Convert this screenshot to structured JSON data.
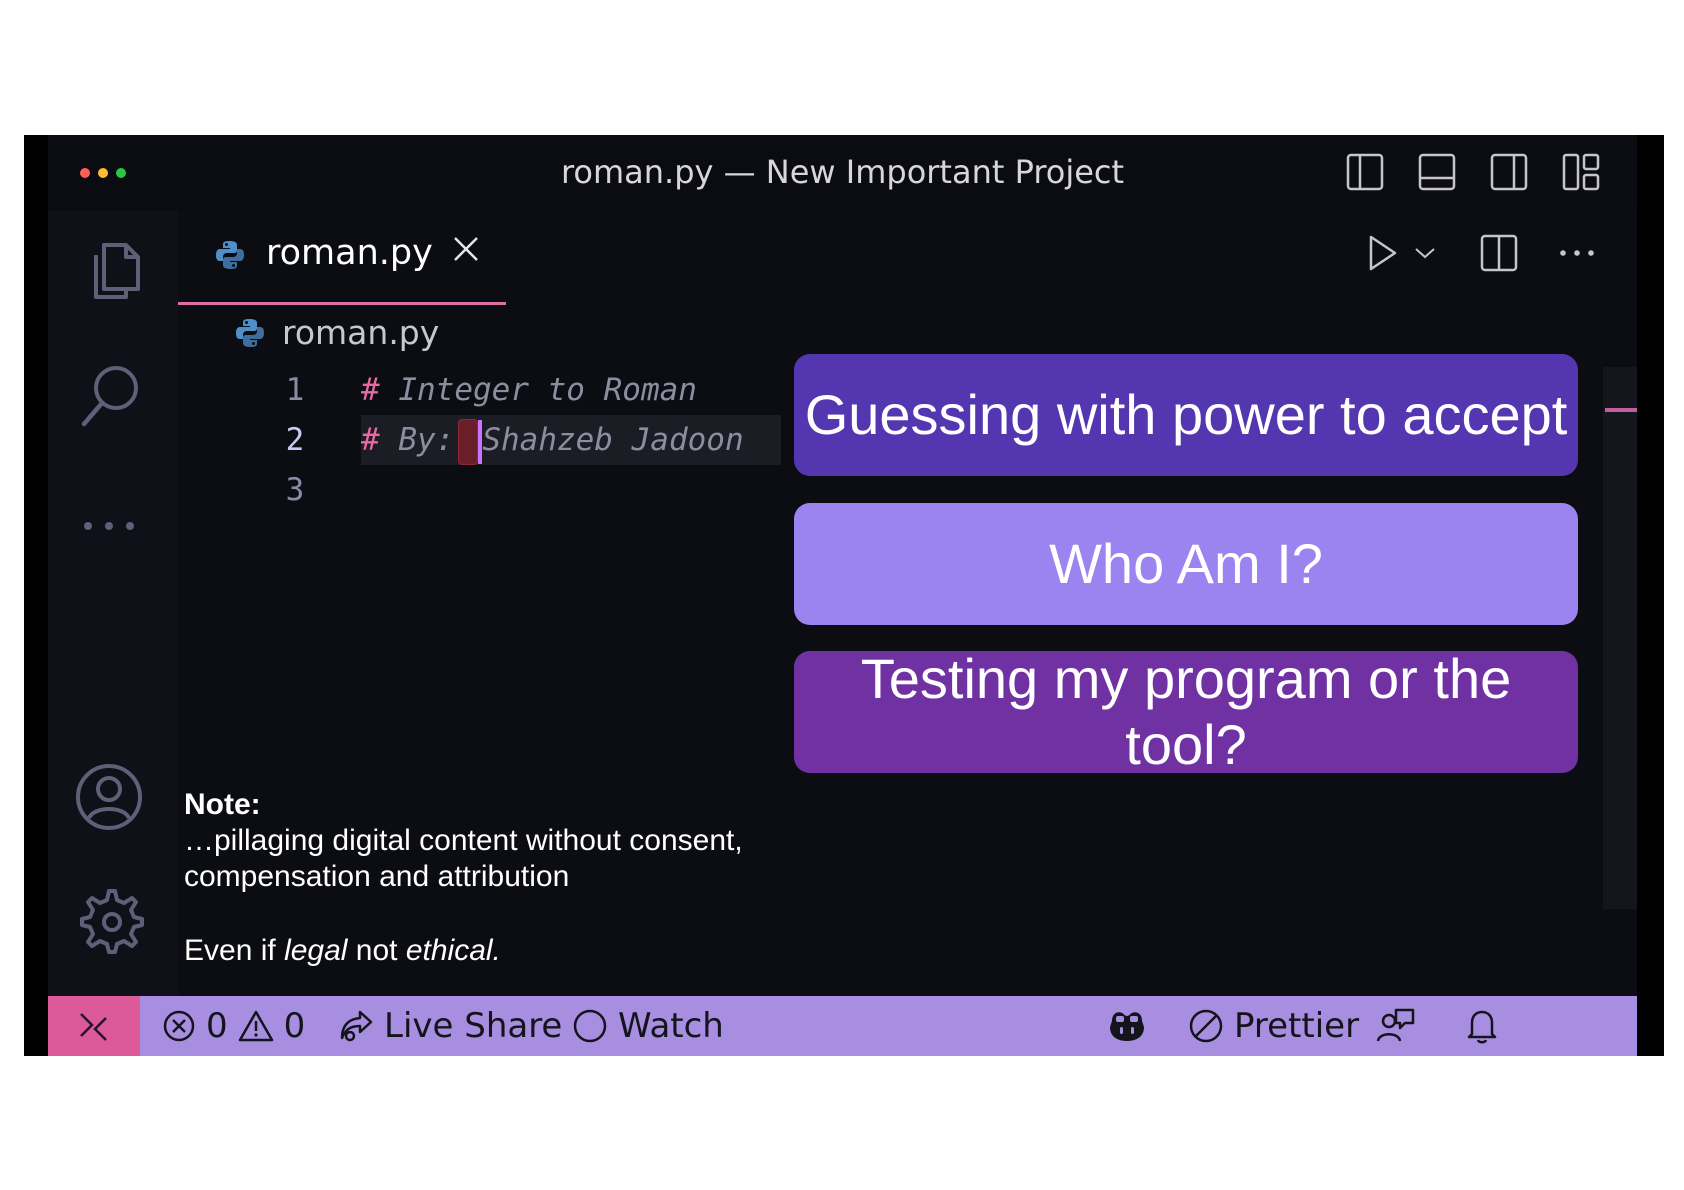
{
  "window": {
    "title": "roman.py — New Important Project",
    "traffic_lights": [
      "#ff5f57",
      "#febc2e",
      "#28c840"
    ],
    "layout_icons": [
      "toggle-primary-sidebar-icon",
      "toggle-panel-icon",
      "toggle-secondary-sidebar-icon",
      "customize-layout-icon"
    ]
  },
  "activity_bar": {
    "items": [
      "explorer-icon",
      "search-icon",
      "more-icon"
    ],
    "bottom": [
      "accounts-icon",
      "settings-gear-icon"
    ]
  },
  "tab": {
    "label": "roman.py",
    "close": "close-icon"
  },
  "editor_actions": [
    "run-icon",
    "chevron-down-icon",
    "split-editor-icon",
    "more-actions-icon"
  ],
  "breadcrumb": {
    "file": "roman.py"
  },
  "code": {
    "line_numbers": [
      "1",
      "2",
      "3"
    ],
    "lines": [
      {
        "hash": "#",
        "text": " Integer to Roman"
      },
      {
        "hash": "#",
        "text": " By:",
        "after_cursor": "Shahzeb Jadoon"
      },
      {
        "hash": "",
        "text": ""
      }
    ]
  },
  "overlay": {
    "button1": "Guessing with power to accept",
    "button2": "Who Am I?",
    "button3": "Testing my program or the tool?"
  },
  "note": {
    "heading": "Note:",
    "line1": "…pillaging digital content without consent, compensation and attribution",
    "even_if": "Even if ",
    "legal": "legal",
    "not": " not ",
    "ethical": "ethical."
  },
  "status_bar": {
    "errors": "0",
    "warnings": "0",
    "live_share": "Live Share",
    "watch": "Watch",
    "prettier": "Prettier",
    "accent": "#a88ee0",
    "remote_color": "#dc5a9a"
  }
}
